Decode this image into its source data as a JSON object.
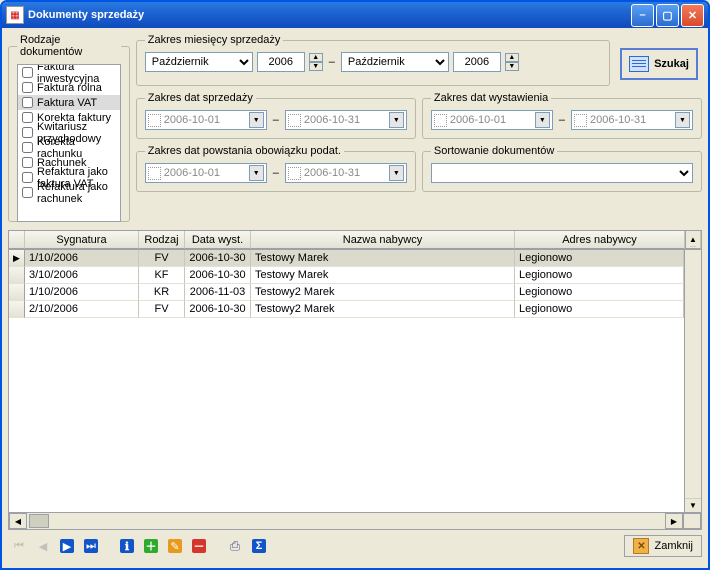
{
  "window": {
    "title": "Dokumenty sprzedaży"
  },
  "doc_types": {
    "legend": "Rodzaje dokumentów",
    "items": [
      {
        "label": "Faktura inwestycyjna",
        "selected": false
      },
      {
        "label": "Faktura rolna",
        "selected": false
      },
      {
        "label": "Faktura VAT",
        "selected": true
      },
      {
        "label": "Korekta faktury",
        "selected": false
      },
      {
        "label": "Kwitariusz przychodowy",
        "selected": false
      },
      {
        "label": "Korekta rachunku",
        "selected": false
      },
      {
        "label": "Rachunek",
        "selected": false
      },
      {
        "label": "Refaktura jako faktura VAT",
        "selected": false
      },
      {
        "label": "Refaktura jako rachunek",
        "selected": false
      }
    ]
  },
  "filters": {
    "months": {
      "legend": "Zakres miesięcy sprzedaży",
      "from_month": "Październik",
      "from_year": "2006",
      "to_month": "Październik",
      "to_year": "2006"
    },
    "sale_dates": {
      "legend": "Zakres dat sprzedaży",
      "from": "2006-10-01",
      "to": "2006-10-31"
    },
    "issue_dates": {
      "legend": "Zakres dat wystawienia",
      "from": "2006-10-01",
      "to": "2006-10-31"
    },
    "tax_dates": {
      "legend": "Zakres dat powstania obowiązku podat.",
      "from": "2006-10-01",
      "to": "2006-10-31"
    },
    "sort": {
      "legend": "Sortowanie dokumentów",
      "value": ""
    }
  },
  "search_label": "Szukaj",
  "grid": {
    "columns": [
      "Sygnatura",
      "Rodzaj",
      "Data wyst.",
      "Nazwa nabywcy",
      "Adres nabywcy"
    ],
    "rows": [
      {
        "sig": "1/10/2006",
        "rod": "FV",
        "date": "2006-10-30",
        "name": "Testowy Marek",
        "addr": "Legionowo",
        "current": true
      },
      {
        "sig": "3/10/2006",
        "rod": "KF",
        "date": "2006-10-30",
        "name": "Testowy Marek",
        "addr": "Legionowo",
        "current": false
      },
      {
        "sig": "1/10/2006",
        "rod": "KR",
        "date": "2006-11-03",
        "name": "Testowy2 Marek",
        "addr": "Legionowo",
        "current": false
      },
      {
        "sig": "2/10/2006",
        "rod": "FV",
        "date": "2006-10-30",
        "name": "Testowy2 Marek",
        "addr": "Legionowo",
        "current": false
      }
    ]
  },
  "toolbar": {
    "first": "⏮",
    "prev": "◀",
    "next": "▶",
    "last": "⏭",
    "info": "ℹ",
    "add": "＋",
    "edit": "✎",
    "del": "－",
    "print": "⎙",
    "sum": "Σ"
  },
  "close_label": "Zamknij"
}
